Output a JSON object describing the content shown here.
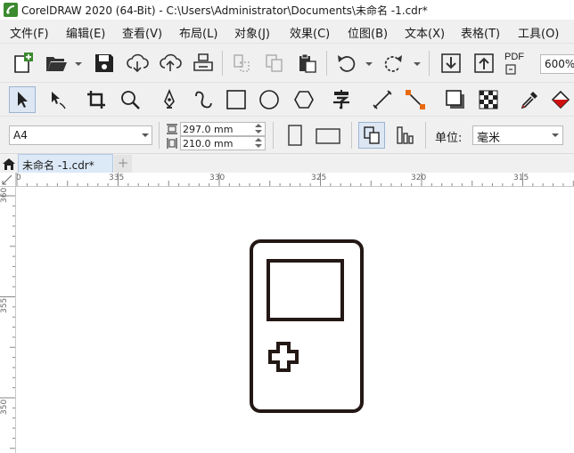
{
  "window": {
    "title": "CorelDRAW 2020 (64-Bit) - C:\\Users\\Administrator\\Documents\\未命名 -1.cdr*"
  },
  "menu": {
    "items": [
      "文件(F)",
      "编辑(E)",
      "查看(V)",
      "布局(L)",
      "对象(J)",
      "效果(C)",
      "位图(B)",
      "文本(X)",
      "表格(T)",
      "工具(O)"
    ]
  },
  "toolbar": {
    "zoom_value": "600%",
    "pdf_label": "PDF"
  },
  "propbar": {
    "page_size": "A4",
    "width_value": "297.0 mm",
    "height_value": "210.0 mm",
    "units_label": "单位:",
    "units_value": "毫米"
  },
  "tabs": {
    "document_tab": "未命名 -1.cdr*",
    "add_tab": "+"
  },
  "rulers": {
    "top_labels": [
      "0",
      "335",
      "330",
      "325",
      "320",
      "315"
    ],
    "left_labels": [
      "360",
      "355",
      "350"
    ]
  },
  "colors": {
    "accent": "#3c8a2f",
    "tab_active": "#dce9f7",
    "shape_stroke": "#231815"
  },
  "icons": {
    "app": "coreldraw-logo-icon",
    "home": "home-icon",
    "new": "new-document-icon",
    "open": "open-folder-icon",
    "save": "save-icon"
  }
}
